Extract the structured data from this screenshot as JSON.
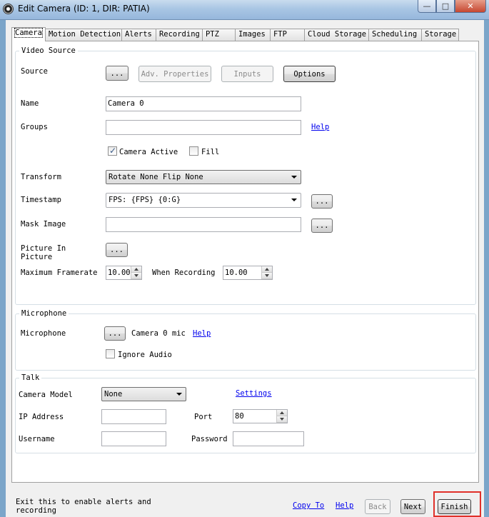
{
  "window": {
    "title": "Edit Camera (ID: 1, DIR: PATIA)",
    "minimize": "—",
    "maximize": "□",
    "close": "✕",
    "accent": "#e0302a"
  },
  "tabs": [
    "Camera",
    "Motion Detection",
    "Alerts",
    "Recording",
    "PTZ",
    "Images",
    "FTP",
    "Cloud Storage",
    "Scheduling",
    "Storage"
  ],
  "video_source": {
    "title": "Video Source",
    "source_label": "Source",
    "source_browse": "...",
    "adv_properties": "Adv. Properties",
    "inputs": "Inputs",
    "options": "Options",
    "name_label": "Name",
    "name_value": "Camera 0",
    "groups_label": "Groups",
    "groups_value": "",
    "help": "Help",
    "camera_active": "Camera Active",
    "fill": "Fill",
    "transform_label": "Transform",
    "transform_value": "Rotate None Flip None",
    "timestamp_label": "Timestamp",
    "timestamp_value": "FPS: {FPS} {0:G}",
    "timestamp_browse": "...",
    "mask_label": "Mask Image",
    "mask_value": "",
    "mask_browse": "...",
    "pip_label_1": "Picture In",
    "pip_label_2": "Picture",
    "pip_browse": "...",
    "max_fps_label": "Maximum Framerate",
    "max_fps_value": "10.00",
    "when_recording_label": "When Recording",
    "when_recording_value": "10.00"
  },
  "microphone": {
    "title": "Microphone",
    "label": "Microphone",
    "browse": "...",
    "device": "Camera 0 mic",
    "help": "Help",
    "ignore_audio": "Ignore Audio"
  },
  "talk": {
    "title": "Talk",
    "model_label": "Camera Model",
    "model_value": "None",
    "settings": "Settings",
    "ip_label": "IP Address",
    "ip_value": "",
    "port_label": "Port",
    "port_value": "80",
    "username_label": "Username",
    "username_value": "",
    "password_label": "Password",
    "password_value": ""
  },
  "footer": {
    "hint": "Exit this to enable alerts and recording",
    "copy_to": "Copy To",
    "help": "Help",
    "back": "Back",
    "next": "Next",
    "finish": "Finish"
  }
}
